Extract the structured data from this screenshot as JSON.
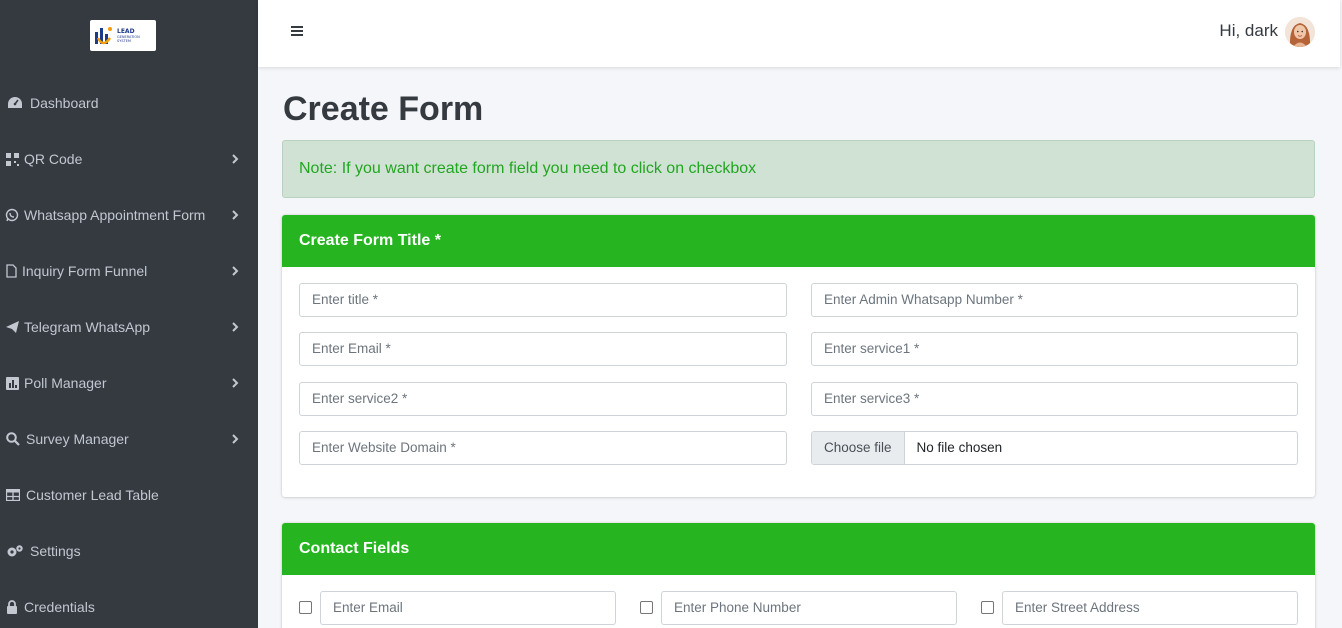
{
  "brand": {
    "logo_text_line1": "LEAD",
    "logo_text_line2": "GENERATION",
    "logo_text_line3": "SYSTEM"
  },
  "sidebar": {
    "items": [
      {
        "label": "Dashboard",
        "icon": "dashboard-icon",
        "has_submenu": false
      },
      {
        "label": "QR Code",
        "icon": "qr-code-icon",
        "has_submenu": true
      },
      {
        "label": "Whatsapp Appointment Form",
        "icon": "whatsapp-icon",
        "has_submenu": true
      },
      {
        "label": "Inquiry Form Funnel",
        "icon": "file-icon",
        "has_submenu": true
      },
      {
        "label": "Telegram WhatsApp",
        "icon": "telegram-icon",
        "has_submenu": true
      },
      {
        "label": "Poll Manager",
        "icon": "poll-icon",
        "has_submenu": true
      },
      {
        "label": "Survey Manager",
        "icon": "search-icon",
        "has_submenu": true
      },
      {
        "label": "Customer Lead Table",
        "icon": "table-icon",
        "has_submenu": false
      },
      {
        "label": "Settings",
        "icon": "gears-icon",
        "has_submenu": false
      },
      {
        "label": "Credentials",
        "icon": "lock-icon",
        "has_submenu": false
      }
    ]
  },
  "topbar": {
    "greeting": "Hi, dark"
  },
  "page": {
    "title": "Create Form",
    "note": "Note: If you want create form field you need to click on checkbox"
  },
  "form_title_card": {
    "header": "Create Form Title *",
    "fields": {
      "title_placeholder": "Enter title *",
      "admin_whatsapp_placeholder": "Enter Admin Whatsapp Number *",
      "email_placeholder": "Enter Email *",
      "service1_placeholder": "Enter service1 *",
      "service2_placeholder": "Enter service2 *",
      "service3_placeholder": "Enter service3 *",
      "website_placeholder": "Enter Website Domain *",
      "file_button": "Choose file",
      "file_status": "No file chosen"
    }
  },
  "contact_card": {
    "header": "Contact Fields",
    "fields": [
      {
        "placeholder": "Enter Email",
        "checked": false
      },
      {
        "placeholder": "Enter Phone Number",
        "checked": false
      },
      {
        "placeholder": "Enter Street Address",
        "checked": false
      }
    ]
  },
  "colors": {
    "sidebar_bg": "#343a40",
    "sidebar_text": "#c2c7d0",
    "accent_green": "#26b521",
    "note_bg": "#d0e2d4",
    "note_text": "#23a521",
    "page_bg": "#f4f6f9"
  }
}
